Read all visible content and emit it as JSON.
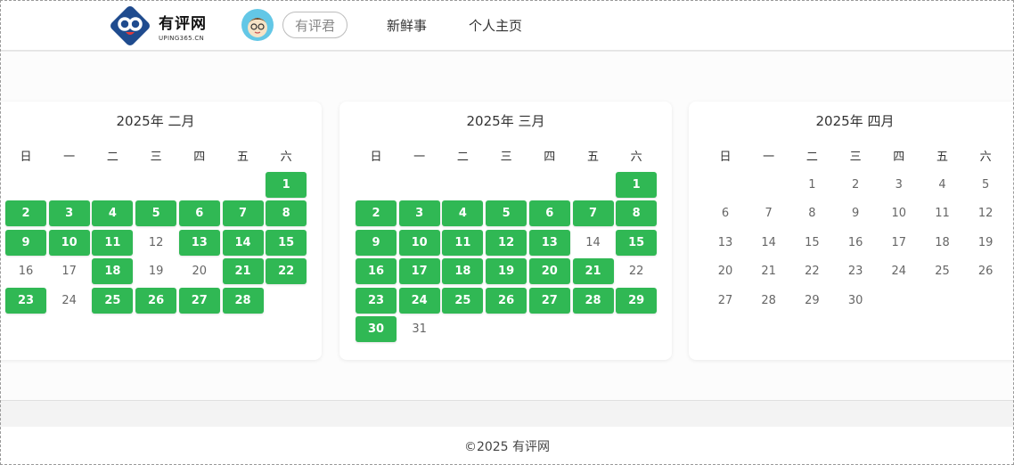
{
  "header": {
    "logo_title": "有评网",
    "logo_sub": "UPING365.CN",
    "user_name": "有评君",
    "nav": [
      "新鲜事",
      "个人主页"
    ]
  },
  "colors": {
    "checked": "#30b854",
    "brand": "#1f4b8e"
  },
  "weekdays": [
    "日",
    "一",
    "二",
    "三",
    "四",
    "五",
    "六"
  ],
  "months": [
    {
      "title": "2025年 二月",
      "first_weekday": 6,
      "days": 28,
      "checked": [
        1,
        2,
        3,
        4,
        5,
        6,
        7,
        8,
        9,
        10,
        11,
        13,
        14,
        15,
        18,
        21,
        22,
        23,
        25,
        26,
        27,
        28
      ]
    },
    {
      "title": "2025年 三月",
      "first_weekday": 6,
      "days": 31,
      "checked": [
        1,
        2,
        3,
        4,
        5,
        6,
        7,
        8,
        9,
        10,
        11,
        12,
        13,
        15,
        16,
        17,
        18,
        19,
        20,
        21,
        23,
        24,
        25,
        26,
        27,
        28,
        29,
        30
      ]
    },
    {
      "title": "2025年 四月",
      "first_weekday": 2,
      "days": 30,
      "checked": []
    }
  ],
  "footer": {
    "text": "©2025  有评网"
  }
}
